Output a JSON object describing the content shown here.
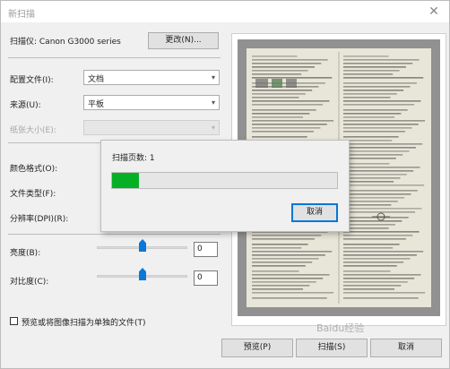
{
  "window": {
    "title": "新扫描"
  },
  "scanner": {
    "label": "扫描仪: Canon G3000 series",
    "change_button": "更改(N)..."
  },
  "fields": {
    "profile_label": "配置文件(I):",
    "profile_value": "文档",
    "source_label": "来源(U):",
    "source_value": "平板",
    "paper_size_label": "纸张大小(E):",
    "color_format_label": "颜色格式(O):",
    "file_type_label": "文件类型(F):",
    "resolution_label": "分辨率(DPI)(R):",
    "brightness_label": "亮度(B):",
    "brightness_value": "0",
    "contrast_label": "对比度(C):",
    "contrast_value": "0",
    "separate_files_label": "预览或将图像扫描为单独的文件(T)"
  },
  "sliders": {
    "brightness_level": 0.5,
    "contrast_level": 0.5
  },
  "buttons": {
    "preview": "预览(P)",
    "scan": "扫描(S)",
    "cancel": "取消"
  },
  "progress_dialog": {
    "pages_label": "扫描页数: 1",
    "progress": 0.12,
    "cancel_button": "取消"
  },
  "watermark": "Baidu经验",
  "colors": {
    "progress": "#06b025",
    "slider_thumb": "#0a78d7"
  }
}
